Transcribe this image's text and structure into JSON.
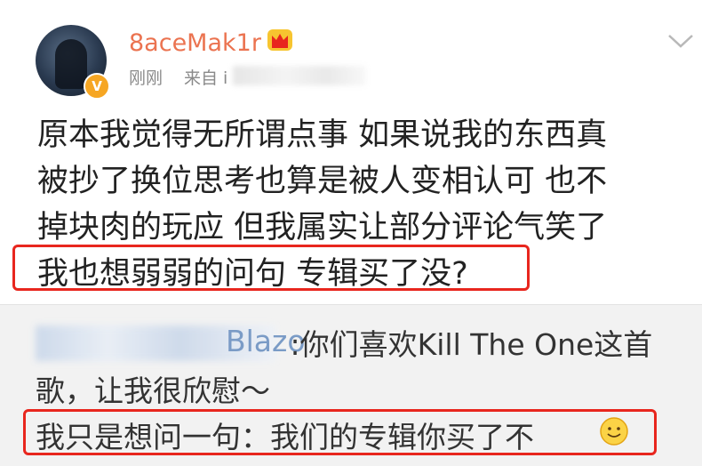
{
  "post": {
    "author": {
      "name": "8aceMak1r",
      "verified_badge": "V"
    },
    "meta": {
      "time": "刚刚",
      "source_prefix": "来自 i"
    },
    "text_lines": [
      "原本我觉得无所谓点事 如果说我的东西真",
      "被抄了换位思考也算是被人变相认可 也不",
      "掉块肉的玩应 但我属实让部分评论气笑了",
      "我也想弱弱的问句 专辑买了没?"
    ],
    "menu_icon": "chevron-down-icon",
    "vip_icon": "crown-icon"
  },
  "repost": {
    "user_visible": "Blazo",
    "line1_rest": " :你们喜欢Kill The One这首",
    "line2": "歌，让我很欣慰～",
    "line3": "我只是想问一句：我们的专辑你买了不",
    "emoji": "smile-icon"
  },
  "colors": {
    "username": "#eb7350",
    "highlight": "#e8261e",
    "repost_bg": "#f2f2f2",
    "link": "#7a9bc6",
    "badge": "#f6a623"
  }
}
